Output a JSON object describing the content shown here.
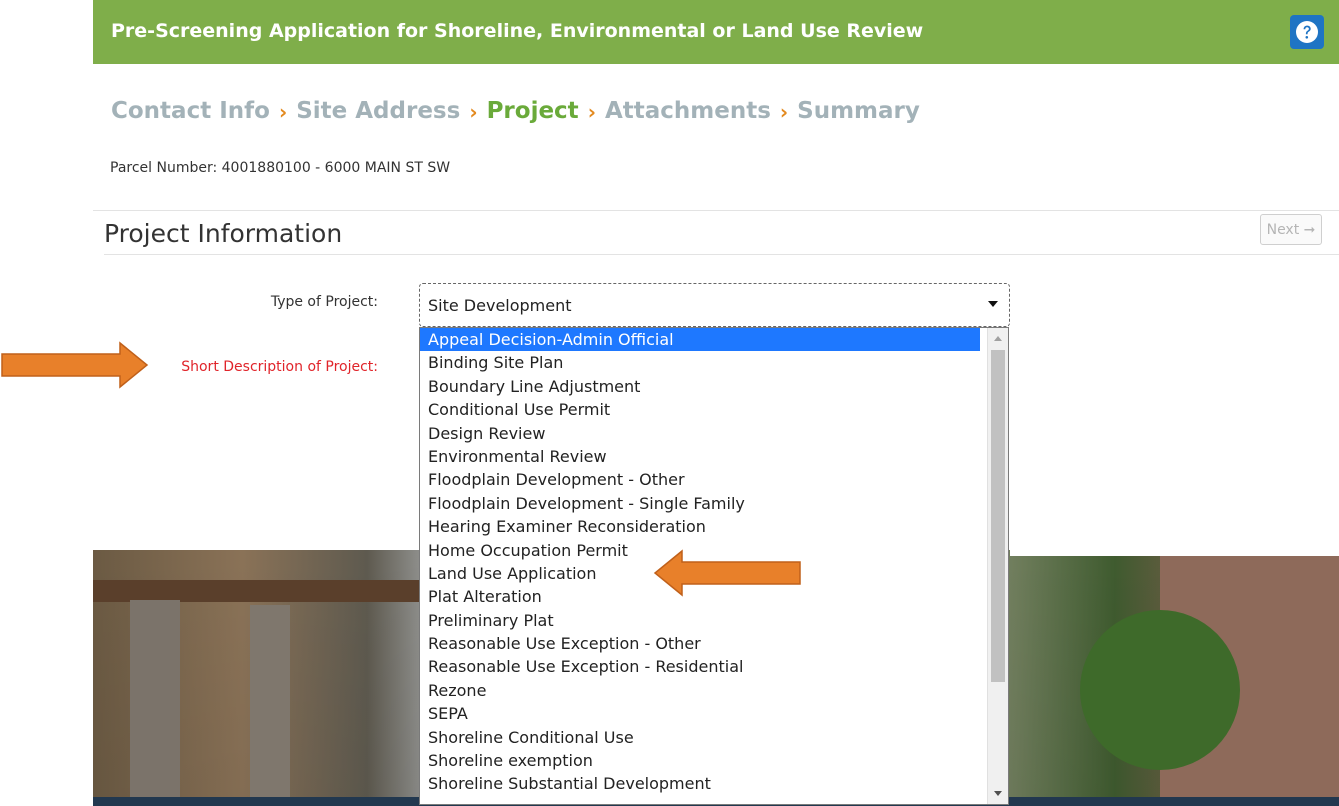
{
  "header": {
    "title": "Pre-Screening Application for Shoreline, Environmental or Land Use Review",
    "help_icon": "question-circle-icon",
    "color": "#7fae4a"
  },
  "breadcrumb": {
    "steps": [
      "Contact Info",
      "Site Address",
      "Project",
      "Attachments",
      "Summary"
    ],
    "active_index": 2,
    "separator": "›"
  },
  "parcel": {
    "text": "Parcel Number: 4001880100 - 6000 MAIN ST SW"
  },
  "section": {
    "title": "Project Information",
    "next_label": "Next ➞"
  },
  "form": {
    "type_label": "Type of Project:",
    "type_value": "Site Development",
    "desc_label": "Short Description of Project:"
  },
  "dropdown": {
    "selected_index": 0,
    "options": [
      "Appeal Decision-Admin Official",
      "Binding Site Plan",
      "Boundary Line Adjustment",
      "Conditional Use Permit",
      "Design Review",
      "Environmental Review",
      "Floodplain Development - Other",
      "Floodplain Development - Single Family",
      "Hearing Examiner Reconsideration",
      "Home Occupation Permit",
      "Land Use Application",
      "Plat Alteration",
      "Preliminary Plat",
      "Reasonable Use Exception - Other",
      "Reasonable Use Exception - Residential",
      "Rezone",
      "SEPA",
      "Shoreline Conditional Use",
      "Shoreline exemption",
      "Shoreline Substantial Development"
    ]
  },
  "colors": {
    "accent_orange": "#e38a1f",
    "active_green": "#6aaa3a",
    "inactive_crumb": "#a3b2b8",
    "required_red": "#e0242a",
    "selection_blue": "#1e78ff"
  }
}
